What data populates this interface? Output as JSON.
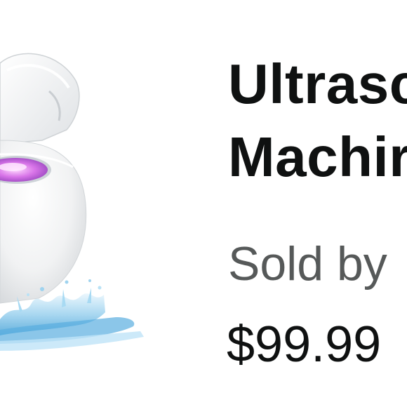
{
  "product": {
    "image_icon": "ultrasonic-cleaner-product-image",
    "title_line_1": "Ultrasc",
    "title_line_2": "Machir",
    "seller_text": "Sold by",
    "price": "$99.99"
  },
  "colors": {
    "title": "#0f1111",
    "seller": "#565959",
    "price": "#0f1111",
    "background": "#ffffff"
  }
}
